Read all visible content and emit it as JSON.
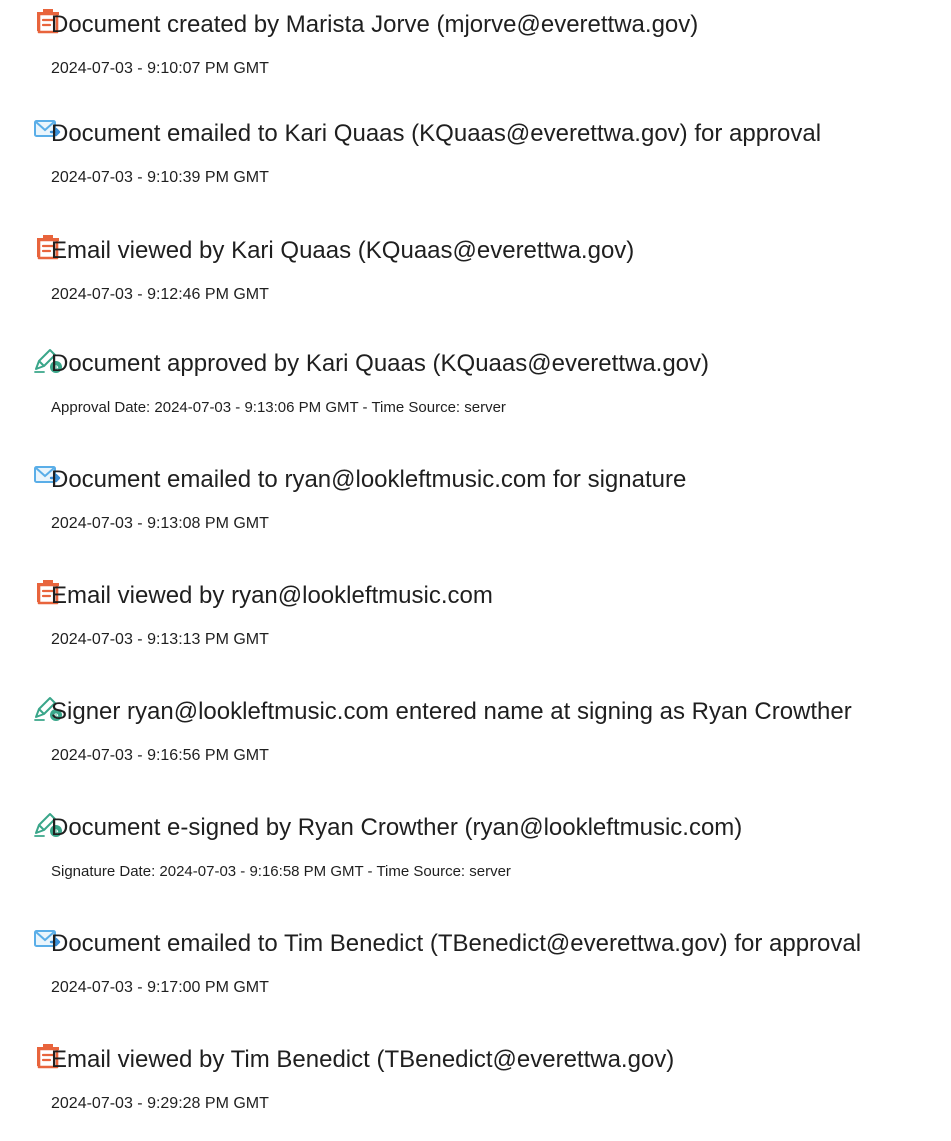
{
  "colors": {
    "view_icon": "#e8643c",
    "email_icon": "#5aaee8",
    "sign_icon": "#3aa68a",
    "text": "#1f1f1f"
  },
  "events": [
    {
      "icon": "document-view-icon",
      "title": "Document created by Marista Jorve (mjorve@everettwa.gov)",
      "time": "2024-07-03 - 9:10:07 PM GMT"
    },
    {
      "icon": "email-send-icon",
      "title": "Document emailed to Kari Quaas (KQuaas@everettwa.gov) for approval",
      "time": "2024-07-03 - 9:10:39 PM GMT"
    },
    {
      "icon": "document-view-icon",
      "title": "Email viewed by Kari Quaas (KQuaas@everettwa.gov)",
      "time": "2024-07-03 - 9:12:46 PM GMT"
    },
    {
      "icon": "pen-sign-icon",
      "title": "Document approved by Kari Quaas (KQuaas@everettwa.gov)",
      "time": "Approval Date: 2024-07-03 - 9:13:06 PM GMT - Time Source: server"
    },
    {
      "icon": "email-send-icon",
      "title": "Document emailed to ryan@lookleftmusic.com for signature",
      "time": "2024-07-03 - 9:13:08 PM GMT"
    },
    {
      "icon": "document-view-icon",
      "title": "Email viewed by ryan@lookleftmusic.com",
      "time": "2024-07-03 - 9:13:13 PM GMT"
    },
    {
      "icon": "pen-sign-icon",
      "title": "Signer ryan@lookleftmusic.com entered name at signing as Ryan Crowther",
      "time": "2024-07-03 - 9:16:56 PM GMT"
    },
    {
      "icon": "pen-sign-icon",
      "title": "Document e-signed by Ryan Crowther (ryan@lookleftmusic.com)",
      "time": "Signature Date: 2024-07-03 - 9:16:58 PM GMT - Time Source: server"
    },
    {
      "icon": "email-send-icon",
      "title": "Document emailed to Tim Benedict (TBenedict@everettwa.gov) for approval",
      "time": "2024-07-03 - 9:17:00 PM GMT"
    },
    {
      "icon": "document-view-icon",
      "title": "Email viewed by Tim Benedict (TBenedict@everettwa.gov)",
      "time": "2024-07-03 - 9:29:28 PM GMT"
    }
  ]
}
